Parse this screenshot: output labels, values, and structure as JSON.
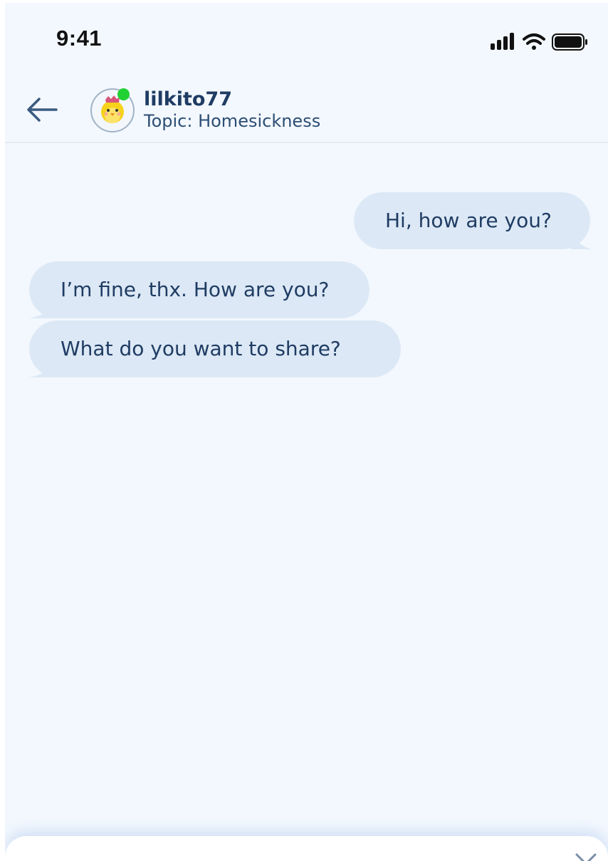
{
  "status_bar": {
    "time": "9:41",
    "signal_icon": "cellular-signal-icon",
    "wifi_icon": "wifi-icon",
    "battery_icon": "battery-icon"
  },
  "header": {
    "back_icon": "back-arrow-icon",
    "username": "lilkito77",
    "topic": "Topic: Homesickness",
    "online_status_color": "#21d133"
  },
  "messages": [
    {
      "direction": "outgoing",
      "text": "Hi, how are you?"
    },
    {
      "direction": "incoming",
      "text": "I’m fine, thx. How are you?"
    },
    {
      "direction": "incoming",
      "text": "What do you want to share?"
    }
  ],
  "bottom_sheet": {
    "close_icon": "close-icon"
  },
  "colors": {
    "background": "#f3f8fe",
    "bubble": "#dce8f5",
    "text": "#1f3c63"
  }
}
